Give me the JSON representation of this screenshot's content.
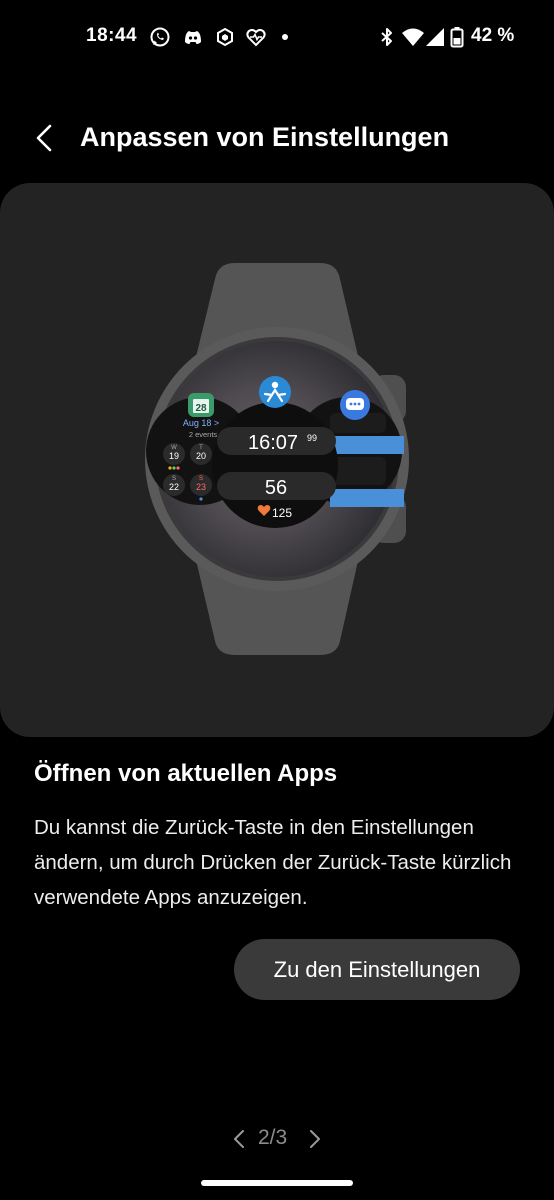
{
  "status_bar": {
    "time": "18:44",
    "battery": "42 %",
    "left_icons": [
      "whatsapp-icon",
      "discord-icon",
      "hexagon-app-icon",
      "health-heart-icon",
      "notification-dot-icon"
    ],
    "right_icons": [
      "bluetooth-icon",
      "wifi-icon",
      "signal-icon",
      "battery-icon"
    ]
  },
  "header": {
    "title": "Anpassen von Einstellungen"
  },
  "illustration": {
    "calendar": {
      "date_badge": "28",
      "date_label": "Aug 18 >",
      "events": "2 events"
    },
    "calendar_days": [
      {
        "weekday": "W",
        "day": "19"
      },
      {
        "weekday": "T",
        "day": "20"
      },
      {
        "weekday": "S",
        "day": "22"
      },
      {
        "weekday": "S",
        "day": "23"
      }
    ],
    "stopwatch": {
      "main": "16:07",
      "fraction": "99"
    },
    "counter": "56",
    "heart_rate": "125",
    "colors": {
      "accent_blue": "#4a90d9",
      "heart": "#f07a3a",
      "calendar_green": "#3a9a6a"
    }
  },
  "content": {
    "heading": "Öffnen von aktuellen Apps",
    "body": "Du kannst die Zurück-Taste in den Einstellungen ändern, um durch Drücken der Zurück-Taste kürzlich verwendete Apps anzuzeigen.",
    "button_label": "Zu den Einstellungen"
  },
  "pager": {
    "label": "2/3"
  }
}
